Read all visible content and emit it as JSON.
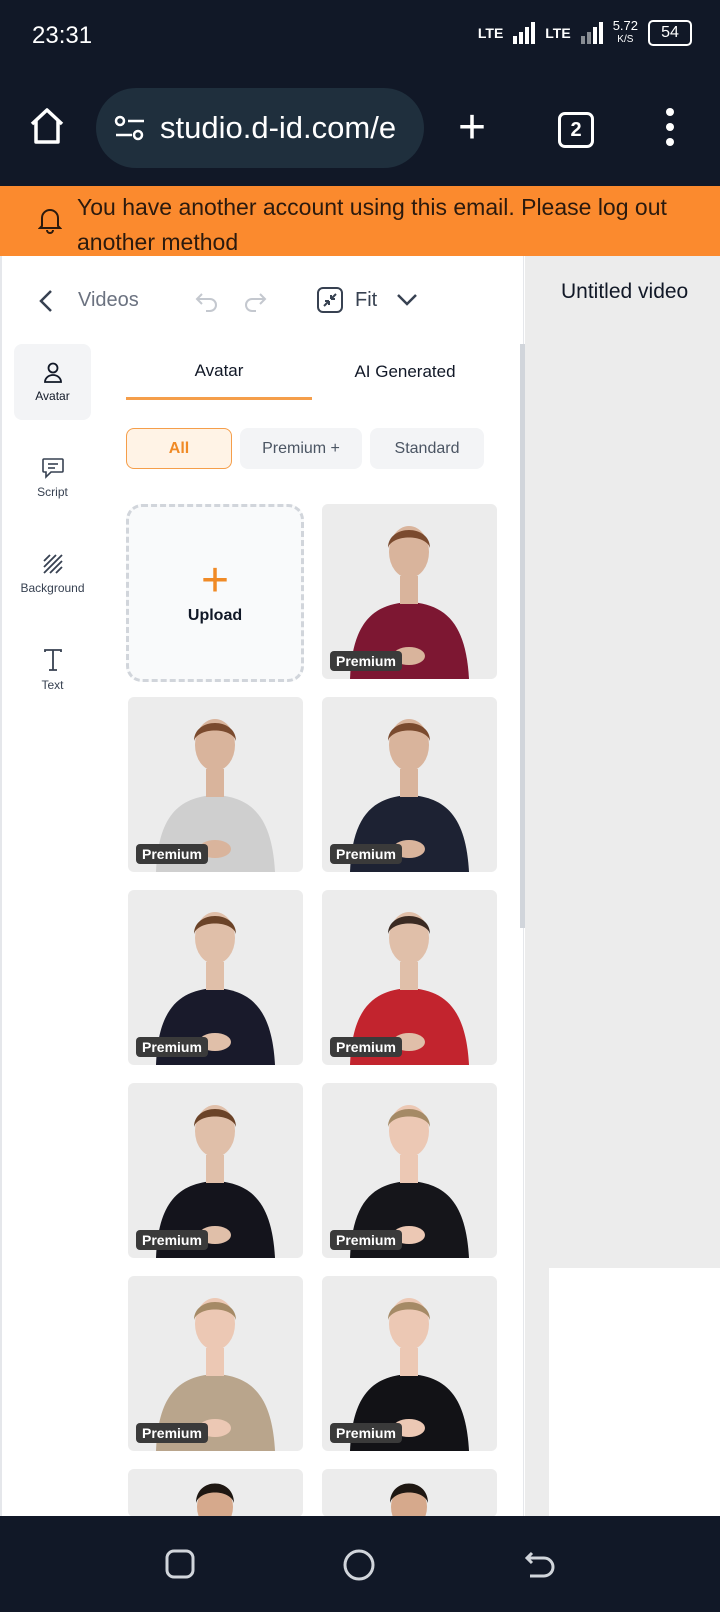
{
  "status": {
    "time": "23:31",
    "net1": "LTE",
    "net2": "LTE",
    "speed_top": "5.72",
    "speed_bottom": "K/S",
    "battery": "54"
  },
  "browser": {
    "url": "studio.d-id.com/e",
    "tab_count": "2"
  },
  "notice": {
    "text": "You have another account using this email. Please log out another method"
  },
  "topbar": {
    "back_label": "Videos",
    "fit_label": "Fit"
  },
  "nav": [
    {
      "label": "Avatar",
      "icon": "person-icon"
    },
    {
      "label": "Script",
      "icon": "chat-icon"
    },
    {
      "label": "Background",
      "icon": "hatch-icon"
    },
    {
      "label": "Text",
      "icon": "text-icon"
    }
  ],
  "tabs": [
    {
      "label": "Avatar"
    },
    {
      "label": "AI Generated"
    }
  ],
  "filters": [
    {
      "label": "All"
    },
    {
      "label": "Premium +"
    },
    {
      "label": "Standard"
    }
  ],
  "upload": {
    "label": "Upload"
  },
  "avatars": [
    {
      "badge": "Premium",
      "shirt": "#7d1732",
      "skin": "#d9b49c",
      "hair": "#7a4a2e"
    },
    {
      "badge": "Premium",
      "shirt": "#cfcfcf",
      "skin": "#d9b49c",
      "hair": "#7a4a2e"
    },
    {
      "badge": "Premium",
      "shirt": "#1d2233",
      "skin": "#d9b49c",
      "hair": "#7a4a2e"
    },
    {
      "badge": "Premium",
      "shirt": "#191a2b",
      "skin": "#e0bfa9",
      "hair": "#6b4328"
    },
    {
      "badge": "Premium",
      "shirt": "#c2242e",
      "skin": "#e0bfa9",
      "hair": "#3a2a22"
    },
    {
      "badge": "Premium",
      "shirt": "#14141c",
      "skin": "#e0bfa9",
      "hair": "#6b4328"
    },
    {
      "badge": "Premium",
      "shirt": "#15151a",
      "skin": "#ecc8b4",
      "hair": "#a58a66"
    },
    {
      "badge": "Premium",
      "shirt": "#b9a58c",
      "skin": "#ecc8b4",
      "hair": "#a58a66"
    },
    {
      "badge": "Premium",
      "shirt": "#121216",
      "skin": "#ecc8b4",
      "hair": "#a58a66"
    }
  ],
  "canvas": {
    "title": "Untitled video"
  }
}
